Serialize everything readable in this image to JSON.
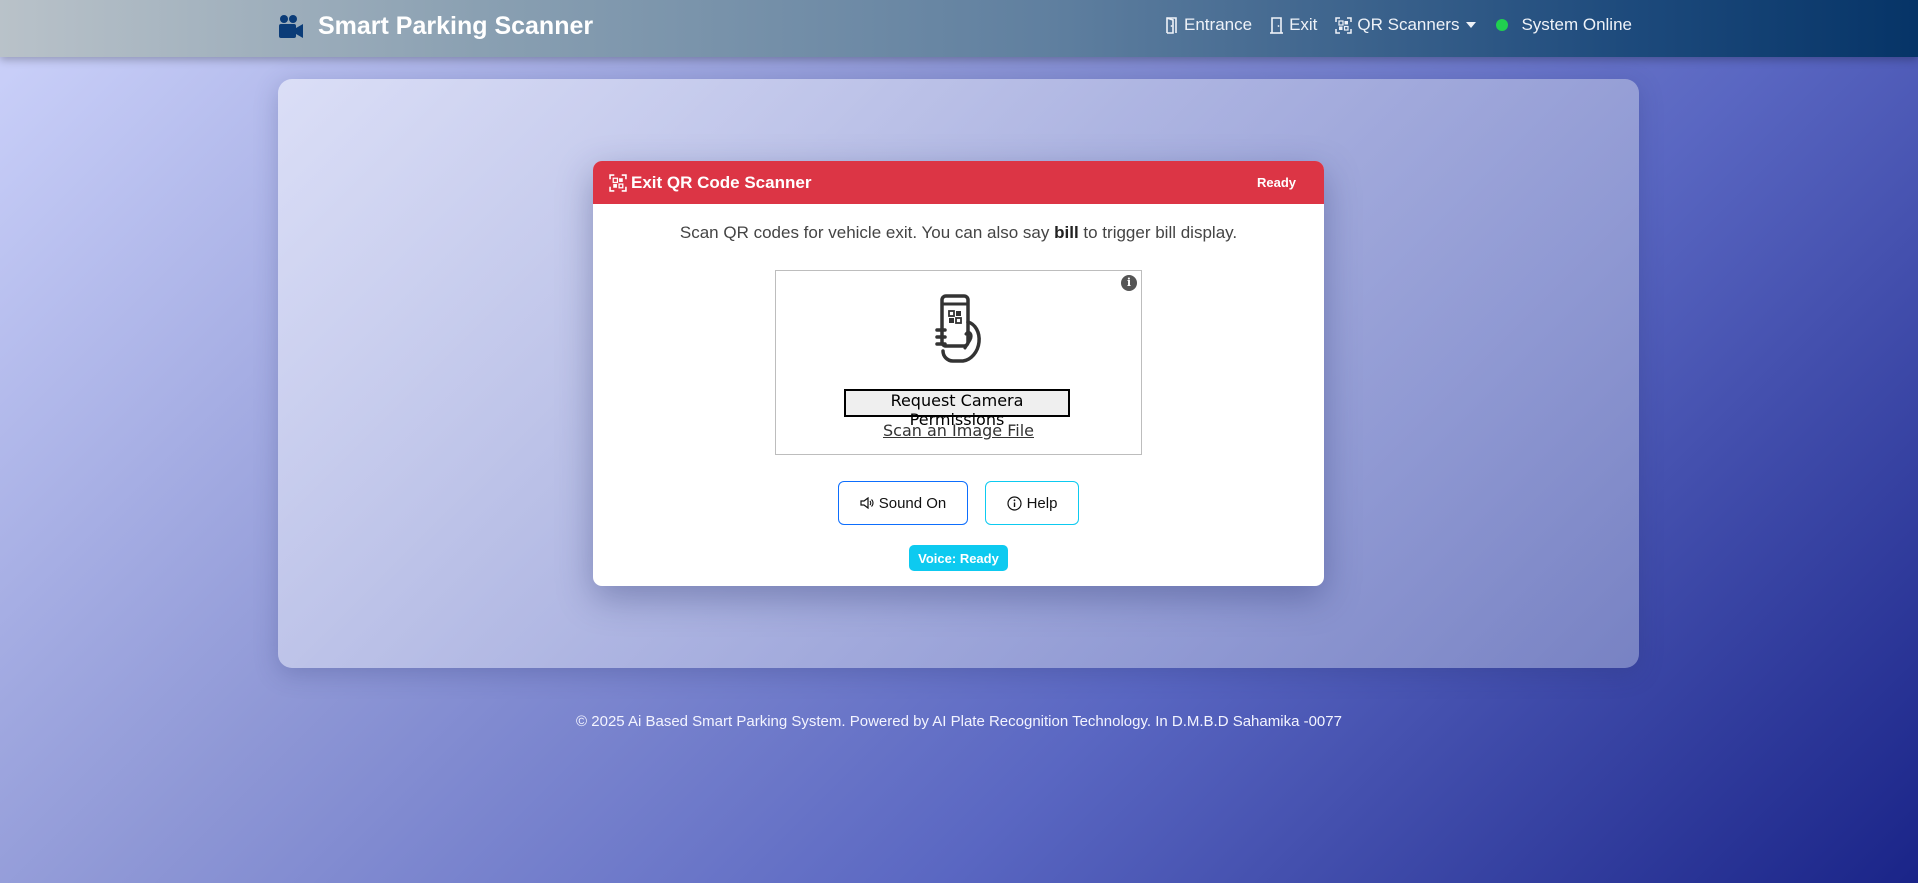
{
  "navbar": {
    "brand": "Smart Parking Scanner",
    "brand_icon": "video-camera-icon",
    "links": {
      "entrance": "Entrance",
      "exit": "Exit",
      "qr_scanners": "QR Scanners"
    },
    "status": "System Online",
    "status_color": "#20d04f"
  },
  "scanner": {
    "title": "Exit QR Code Scanner",
    "badge": "Ready",
    "header_color": "#dc3545",
    "instructions_before": "Scan QR codes for vehicle exit. You can also say",
    "instructions_keyword": "bill",
    "instructions_after": "to trigger bill display.",
    "info_icon_glyph": "i",
    "request_permissions": "Request Camera Permissions",
    "scan_image_file": "Scan an Image File",
    "sound_button": "Sound On",
    "help_button": "Help",
    "voice_status": "Voice: Ready"
  },
  "footer": {
    "text": "© 2025 Ai Based Smart Parking System. Powered by AI Plate Recognition Technology. In D.M.B.D Sahamika -0077"
  }
}
